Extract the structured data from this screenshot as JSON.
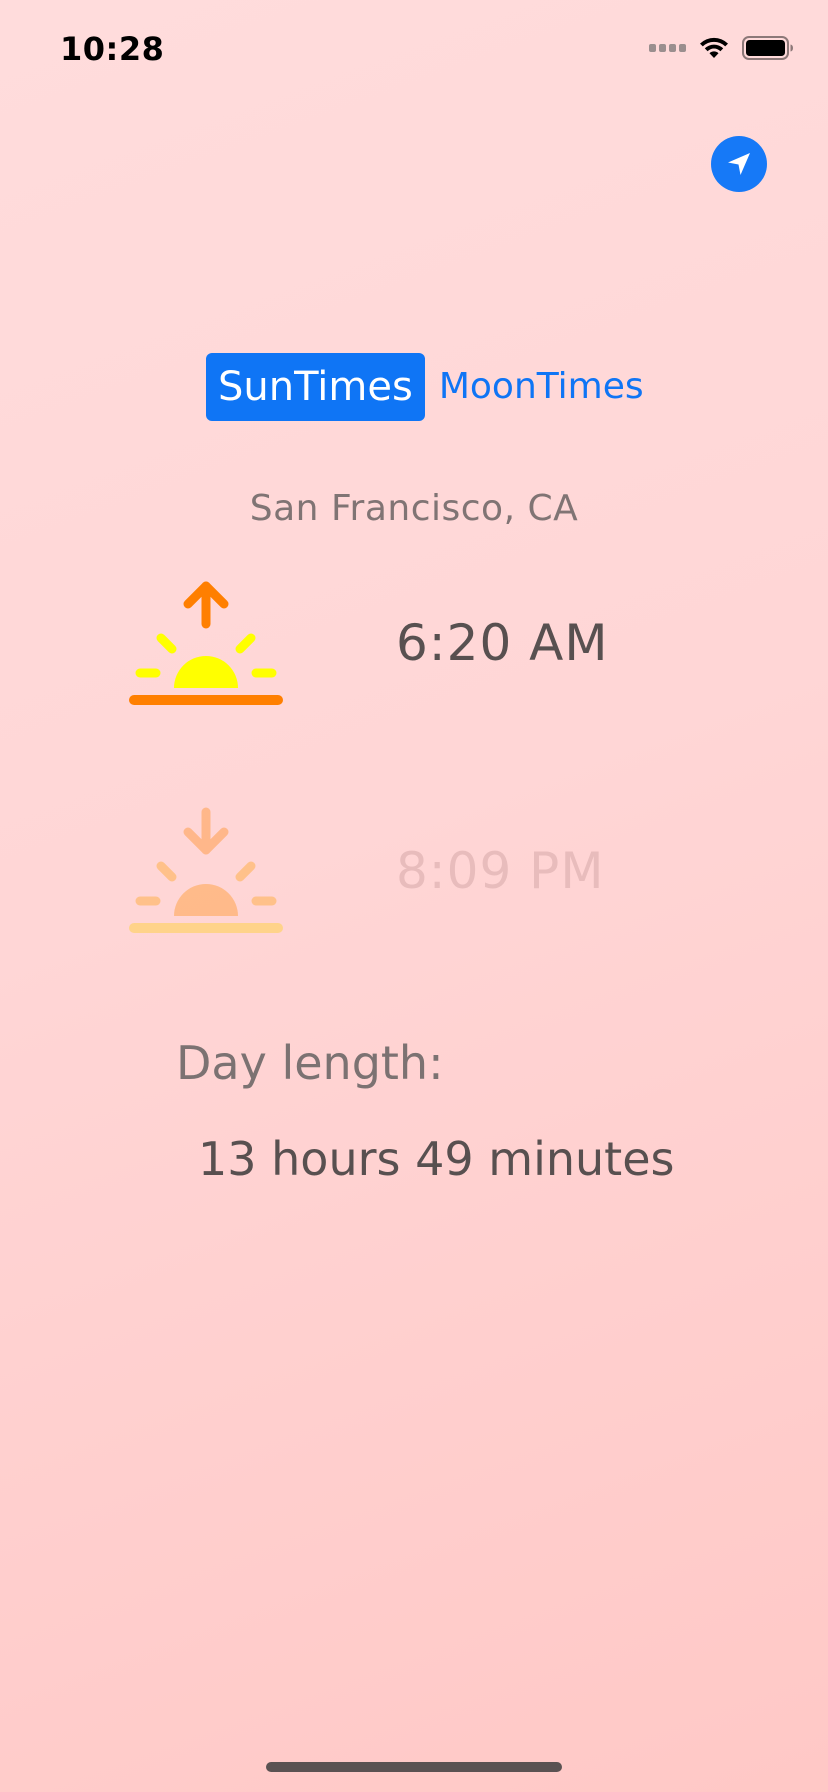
{
  "status_bar": {
    "time": "10:28",
    "signal_icon": "signal-bars-icon",
    "wifi_icon": "wifi-icon",
    "battery_icon": "battery-icon"
  },
  "toolbar": {
    "location_icon": "location-arrow-icon",
    "accent_color": "#1679f7"
  },
  "segmented_control": {
    "options": [
      "SunTimes",
      "MoonTimes"
    ],
    "selected": "SunTimes"
  },
  "location": "San Francisco, CA",
  "sunrise": {
    "icon": "sunrise-icon",
    "time": "6:20 AM"
  },
  "sunset": {
    "icon": "sunset-icon",
    "time": "8:09 PM"
  },
  "day_length": {
    "label": "Day length:",
    "value": "13 hours 49 minutes"
  },
  "colors": {
    "background": "#ffd6d6",
    "sun": "#ffff00",
    "arrow": "#ff7f00",
    "primary_text": "#585050",
    "secondary_text": "#807474"
  }
}
